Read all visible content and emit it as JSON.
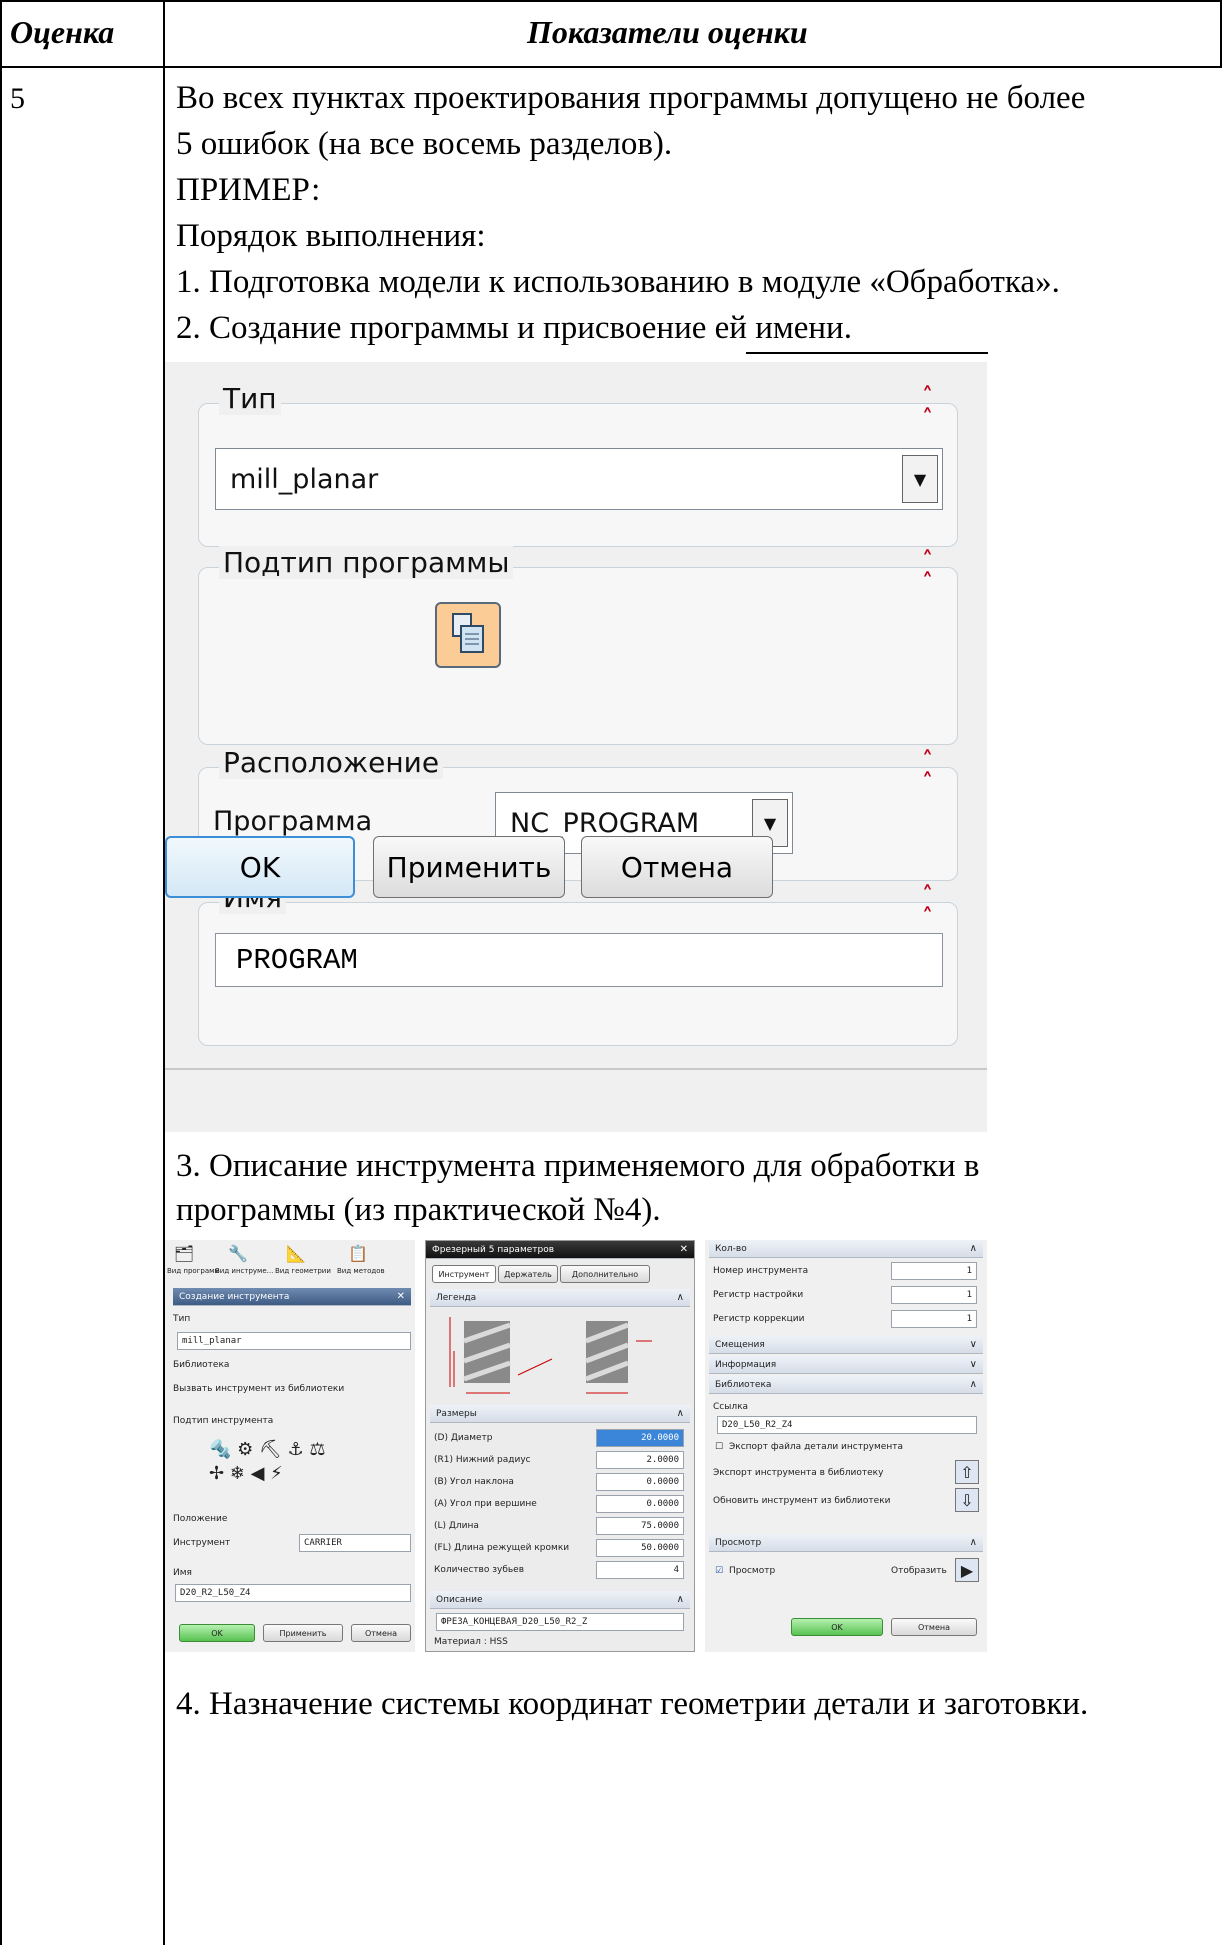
{
  "table": {
    "header_score": "Оценка",
    "header_criteria": "Показатели оценки",
    "score": "5"
  },
  "text": {
    "line1": "Во всех пунктах проектирования программы допущено не более",
    "line2": "5 ошибок (на все восемь разделов).",
    "line3": "ПРИМЕР:",
    "line4": "Порядок выполнения:",
    "line5": "1. Подготовка модели к использованию в модуле «Обработка».",
    "line6": "2. Создание программы и присвоение ей имени.",
    "line7": "3. Описание инструмента применяемого для обработки в",
    "line8": "программы (из практической №4).",
    "line9": "4. Назначение системы координат геометрии детали и заготовки."
  },
  "dialog1": {
    "type_title": "Тип",
    "type_value": "mill_planar",
    "subtype_title": "Подтип программы",
    "location_title": "Расположение",
    "program_label": "Программа",
    "program_value": "NC_PROGRAM",
    "name_title": "Имя",
    "name_value": "PROGRAM",
    "ok": "OK",
    "apply": "Применить",
    "cancel": "Отмена"
  },
  "dialog2": {
    "left": {
      "tb1": "Вид программ",
      "tb2": "Вид инструме...",
      "tb3": "Вид геометрии",
      "tb4": "Вид методов",
      "title": "Создание инструмента",
      "type_title": "Тип",
      "type_value": "mill_planar",
      "library_title": "Библиотека",
      "library_text": "Вызвать инструмент из библиотеки",
      "subtype_title": "Подтип инструмента",
      "position_title": "Положение",
      "tool_label": "Инструмент",
      "tool_value": "CARRIER",
      "name_title": "Имя",
      "name_value": "D20_R2_L50_Z4",
      "ok": "OK",
      "apply": "Применить",
      "cancel": "Отмена"
    },
    "mid": {
      "title": "Фрезерный 5 параметров",
      "tab1": "Инструмент",
      "tab2": "Держатель",
      "tab3": "Дополнительно",
      "legend": "Легенда",
      "sizes": "Размеры",
      "params": [
        {
          "label": "(D) Диаметр",
          "value": "20.0000"
        },
        {
          "label": "(R1) Нижний радиус",
          "value": "2.0000"
        },
        {
          "label": "(B) Угол наклона",
          "value": "0.0000"
        },
        {
          "label": "(A) Угол при вершине",
          "value": "0.0000"
        },
        {
          "label": "(L) Длина",
          "value": "75.0000"
        },
        {
          "label": "(FL) Длина режущей кромки",
          "value": "50.0000"
        },
        {
          "label": "Количество зубьев",
          "value": "4"
        }
      ],
      "desc_title": "Описание",
      "desc_value": "ФРЕЗА_КОНЦЕВАЯ_D20_L50_R2_Z",
      "material": "Материал : HSS"
    },
    "right": {
      "count_title": "Кол-во",
      "tool_no": "Номер инструмента",
      "tool_no_val": "1",
      "adj_reg": "Регистр настройки",
      "adj_reg_val": "1",
      "corr_reg": "Регистр коррекции",
      "corr_reg_val": "1",
      "offsets": "Смещения",
      "info": "Информация",
      "library": "Библиотека",
      "link": "Ссылка",
      "link_value": "D20_L50_R2_Z4",
      "export_file": "Экспорт файла детали инструмента",
      "export_lib": "Экспорт инструмента в библиотеку",
      "update_lib": "Обновить инструмент из библиотеки",
      "preview_title": "Просмотр",
      "preview_chk": "Просмотр",
      "show": "Отобразить",
      "ok": "OK",
      "cancel": "Отмена"
    }
  }
}
